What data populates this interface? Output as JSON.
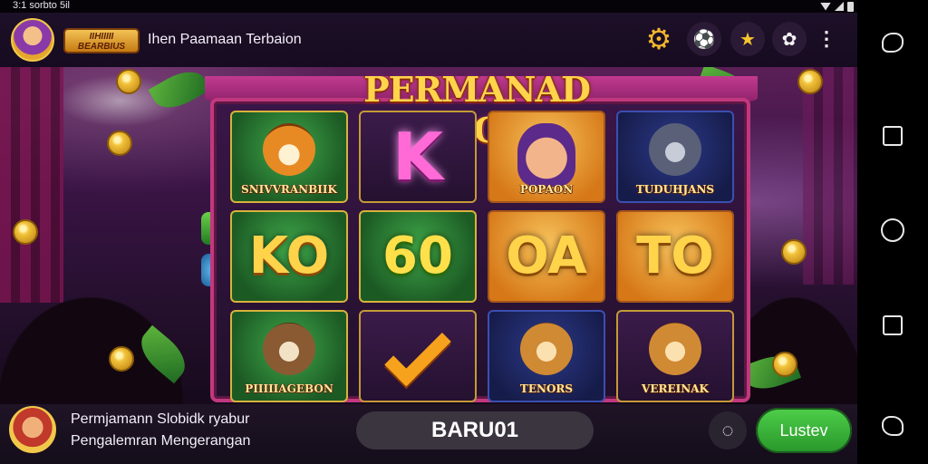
{
  "status_bar": {
    "left_text": "3:1 sorbto 5il"
  },
  "header": {
    "badge_text": "IIHIIIII BEARBIUS",
    "title": "Ihen Paamaan Terbaion"
  },
  "game": {
    "title": "PERMANAD SLOT",
    "reels": [
      {
        "cells": [
          {
            "type": "symbol",
            "style": "g",
            "face": "tiger",
            "label": "SNIVVRANBIIK"
          },
          {
            "type": "text",
            "style": "g",
            "text": "KO"
          },
          {
            "type": "symbol",
            "style": "g",
            "face": "cat",
            "label": "PIIIIIAGEBON"
          }
        ]
      },
      {
        "cells": [
          {
            "type": "text",
            "style": "p",
            "text": "K",
            "variant": "k"
          },
          {
            "type": "text",
            "style": "g",
            "text": "60",
            "variant": "g60"
          },
          {
            "type": "check",
            "style": "p"
          }
        ]
      },
      {
        "cells": [
          {
            "type": "symbol",
            "style": "o",
            "face": "woman",
            "label": "POPAON"
          },
          {
            "type": "text",
            "style": "o",
            "text": "OA"
          },
          {
            "type": "symbol",
            "style": "b",
            "face": "lion",
            "label": "TENORS"
          }
        ]
      },
      {
        "cells": [
          {
            "type": "symbol",
            "style": "b",
            "face": "wolf",
            "label": "TUDUHJANS"
          },
          {
            "type": "text",
            "style": "o",
            "text": "TO"
          },
          {
            "type": "symbol",
            "style": "p",
            "face": "lion",
            "label": "VEREINAK"
          }
        ]
      }
    ]
  },
  "bottom_bar": {
    "promo_line1": "Permjamann Slobidk ryabur",
    "promo_line2": "Pengalemran Mengerangan",
    "code_value": "BARU01",
    "cta_label": "Lustev"
  },
  "colors": {
    "accent": "#f2b62c",
    "cta_green": "#3cba3a",
    "curtain": "#c2387f"
  },
  "icons": {
    "header": [
      "gear-icon",
      "soccer-ball-icon",
      "star-icon",
      "settings-icon",
      "more-vertical-icon"
    ],
    "nav": [
      "assistant-icon",
      "square-icon",
      "home-icon",
      "recents-icon",
      "puzzle-icon"
    ],
    "bottom": [
      "chat-icon"
    ]
  }
}
